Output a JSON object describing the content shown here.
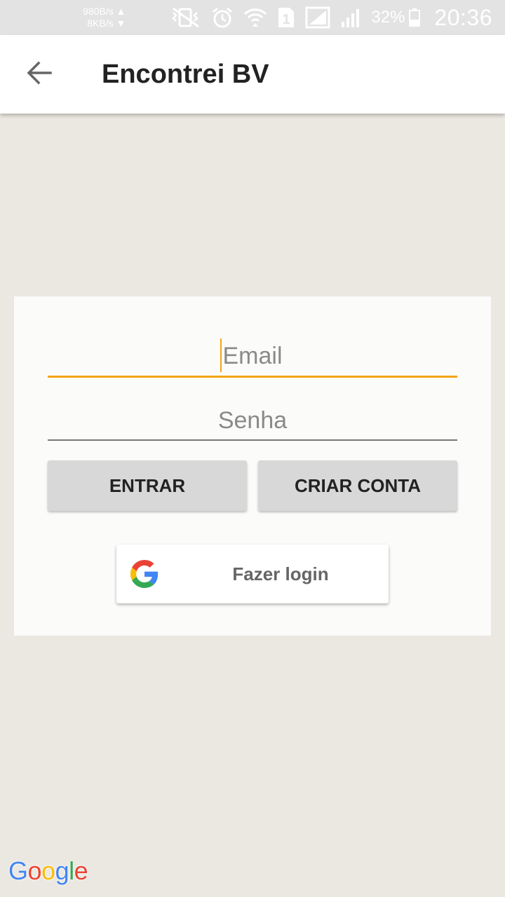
{
  "status_bar": {
    "upload_speed": "980B/s ▲",
    "download_speed": "8KB/s ▼",
    "sim_slot": "1",
    "battery": "32%",
    "time": "20:36",
    "icons": [
      "vibrate-mute-icon",
      "alarm-icon",
      "wifi-icon",
      "sim-1-icon",
      "signal-icon",
      "signal-weak-icon",
      "battery-icon"
    ]
  },
  "app_bar": {
    "back_icon": "arrow-back-icon",
    "title": "Encontrei BV"
  },
  "login": {
    "email_placeholder": "Email",
    "password_placeholder": "Senha",
    "enter_label": "ENTRAR",
    "create_label": "CRIAR CONTA",
    "google_label": "Fazer login"
  },
  "watermark": {
    "letters": [
      "G",
      "o",
      "o",
      "g",
      "l",
      "e"
    ]
  },
  "colors": {
    "accent": "#f5a416",
    "background": "#ebe8e1",
    "card": "#fbfbf9",
    "button": "#d8d8d8",
    "google_blue": "#4285F4",
    "google_red": "#EA4335",
    "google_yellow": "#FBBC05",
    "google_green": "#34A853"
  }
}
